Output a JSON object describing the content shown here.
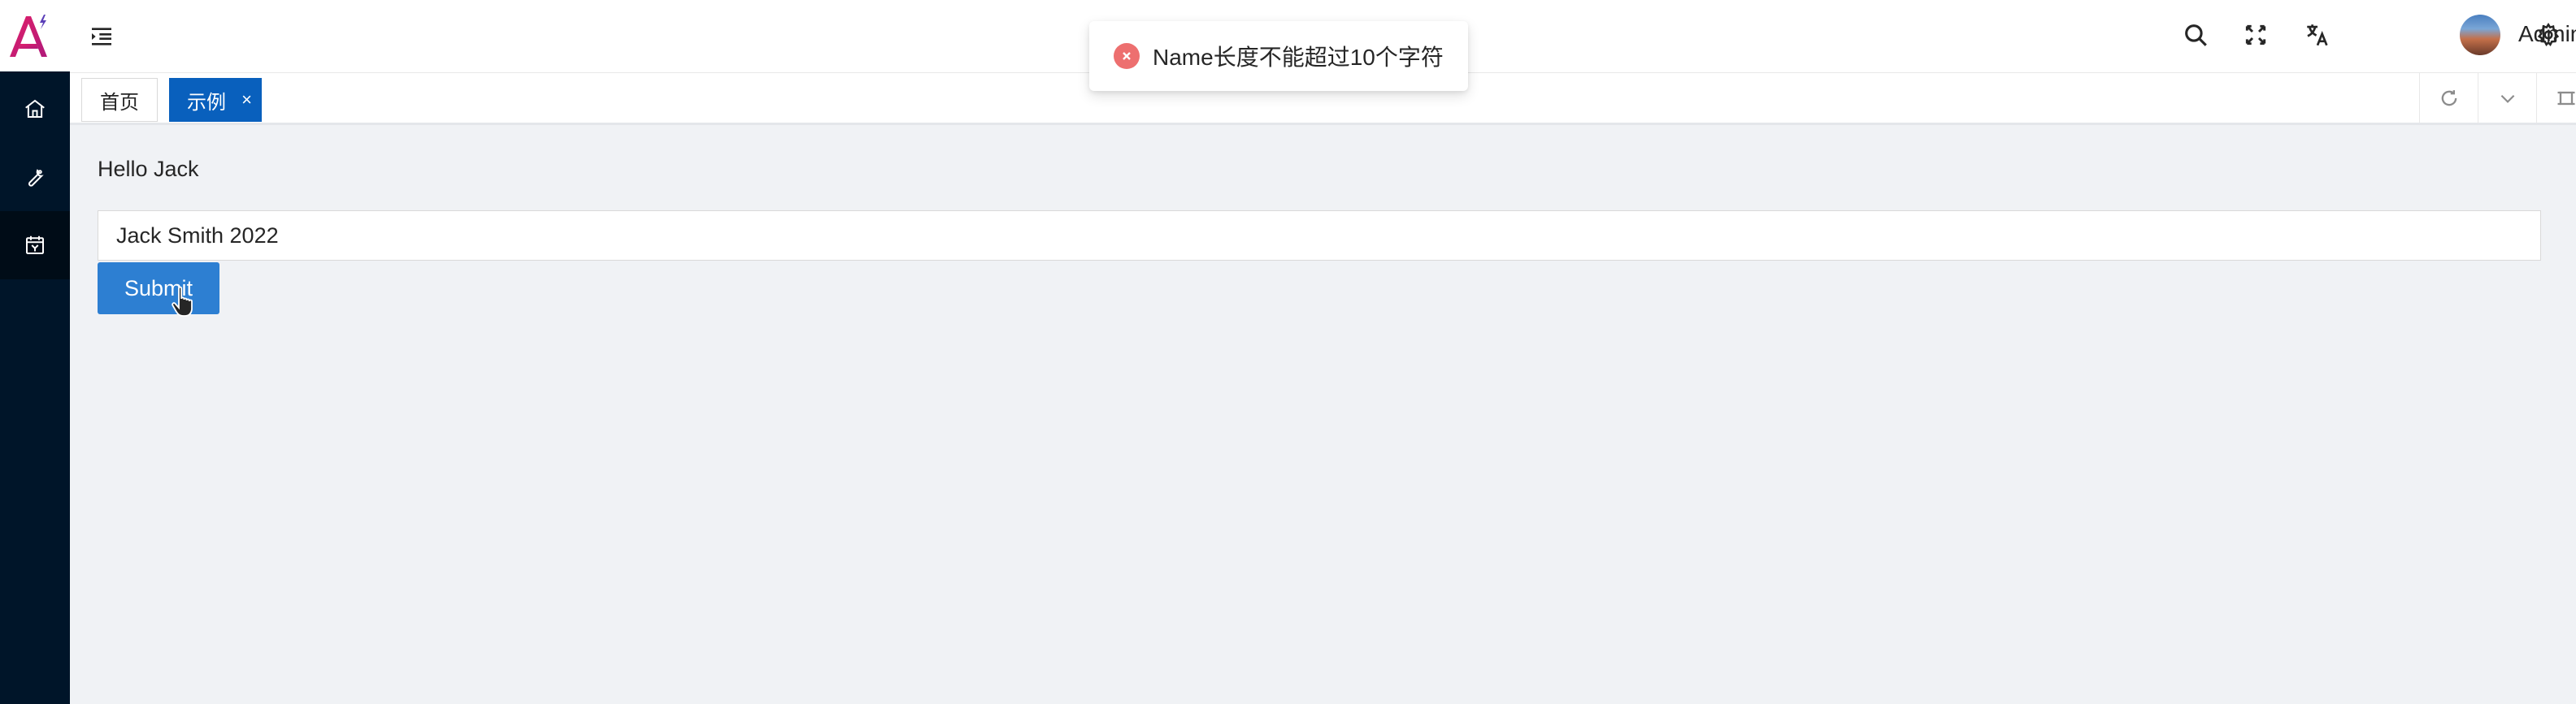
{
  "sidebar": {
    "logo": {
      "name": "logo-a",
      "colors": [
        "#e0206a",
        "#5b3fb8"
      ]
    },
    "items": [
      {
        "icon": "home-icon"
      },
      {
        "icon": "wrench-icon"
      },
      {
        "icon": "calendar-icon",
        "active": true
      }
    ]
  },
  "header": {
    "menu_toggle_icon": "indent-menu-icon",
    "tools": [
      "search-icon",
      "fullscreen-icon",
      "translate-icon"
    ],
    "user": {
      "name": "Admin"
    },
    "settings_icon": "gear-icon"
  },
  "tabs": {
    "items": [
      {
        "label": "首页",
        "active": false
      },
      {
        "label": "示例",
        "active": true,
        "closable": true,
        "close_glyph": "×"
      }
    ],
    "tools": [
      "refresh-icon",
      "chevron-down-icon",
      "maximize-icon"
    ]
  },
  "main": {
    "greeting": "Hello Jack",
    "input_value": "Jack Smith 2022",
    "submit_label": "Submit"
  },
  "toast": {
    "type": "error",
    "message": "Name长度不能超过10个字符"
  },
  "colors": {
    "sidebar_bg": "#001529",
    "accent": "#0960bd",
    "button": "#2d7fd2",
    "error": "#ed6f6f",
    "content_bg": "#f0f2f5"
  }
}
